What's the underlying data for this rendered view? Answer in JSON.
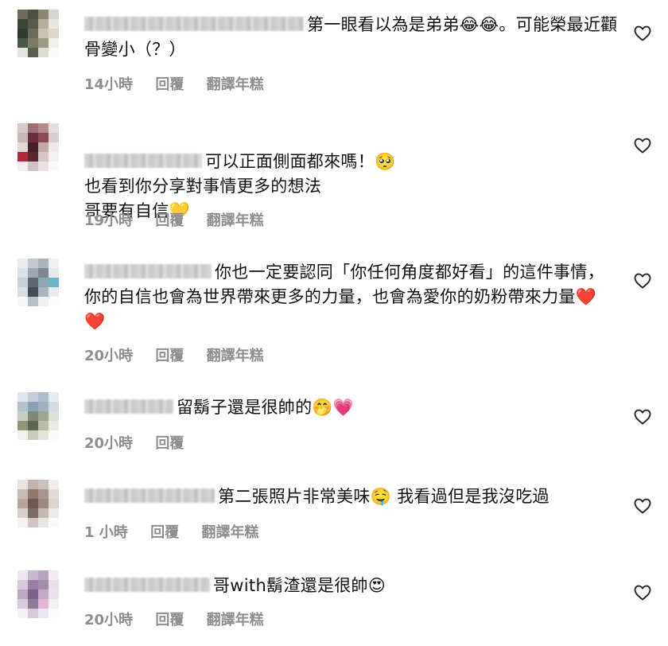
{
  "comments": [
    {
      "text": "第一眼看以為是弟弟😂😂。可能榮最近顴骨變小（？）",
      "time": "14小時",
      "reply": "回覆",
      "translate": "翻譯年糕"
    },
    {
      "text": "可以正面側面都來嗎！🥺\n也看到你分享對事情更多的想法\n哥要有自信💛",
      "time": "19小時",
      "reply": "回覆",
      "translate": "翻譯年糕"
    },
    {
      "text": "你也一定要認同「你任何角度都好看」的這件事情，你的自信也會為世界帶來更多的力量，也會為愛你的奶粉帶來力量❤️❤️",
      "time": "20小時",
      "reply": "回覆",
      "translate": "翻譯年糕"
    },
    {
      "text": "留鬍子還是很帥的🤭💗",
      "time": "20小時",
      "reply": "回覆"
    },
    {
      "text": "第二張照片非常美味🤤 我看過但是我沒吃過",
      "time": "1 小時",
      "reply": "回覆",
      "translate": "翻譯年糕"
    },
    {
      "text": "哥with鬍渣還是很帥😍",
      "time": "20小時",
      "reply": "回覆",
      "translate": "翻譯年糕"
    }
  ],
  "icons": {
    "like": "heart-outline-icon"
  },
  "colors": {
    "meta": "#8e8e8e",
    "text": "#111111"
  }
}
